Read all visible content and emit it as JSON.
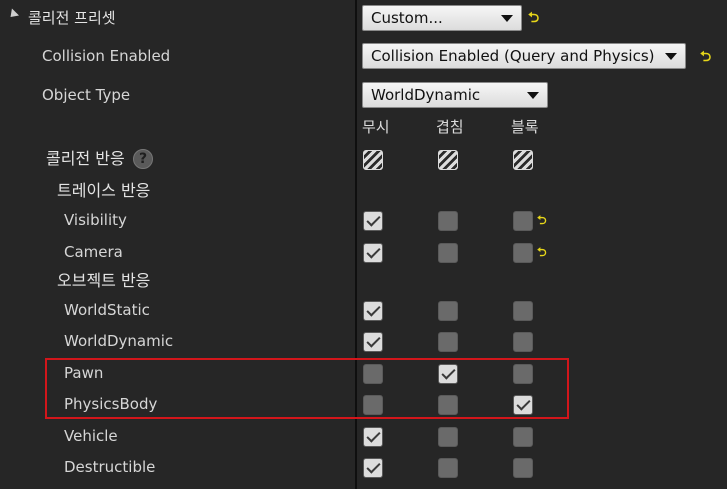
{
  "preset": {
    "label": "콜리전 프리셋",
    "value": "Custom..."
  },
  "collision_enabled": {
    "label": "Collision Enabled",
    "value": "Collision Enabled (Query and Physics)"
  },
  "object_type": {
    "label": "Object Type",
    "value": "WorldDynamic"
  },
  "columns": [
    "무시",
    "겹침",
    "블록"
  ],
  "collision_response": {
    "label": "콜리전 반응"
  },
  "trace_response": {
    "label": "트레이스 반응",
    "rows": [
      {
        "name": "Visibility",
        "ignore": true,
        "overlap": false,
        "block": false
      },
      {
        "name": "Camera",
        "ignore": true,
        "overlap": false,
        "block": false
      }
    ]
  },
  "object_response": {
    "label": "오브젝트 반응",
    "rows": [
      {
        "name": "WorldStatic",
        "ignore": true,
        "overlap": false,
        "block": false
      },
      {
        "name": "WorldDynamic",
        "ignore": true,
        "overlap": false,
        "block": false
      },
      {
        "name": "Pawn",
        "ignore": false,
        "overlap": true,
        "block": false
      },
      {
        "name": "PhysicsBody",
        "ignore": false,
        "overlap": false,
        "block": true
      },
      {
        "name": "Vehicle",
        "ignore": true,
        "overlap": false,
        "block": false
      },
      {
        "name": "Destructible",
        "ignore": true,
        "overlap": false,
        "block": false
      }
    ]
  }
}
